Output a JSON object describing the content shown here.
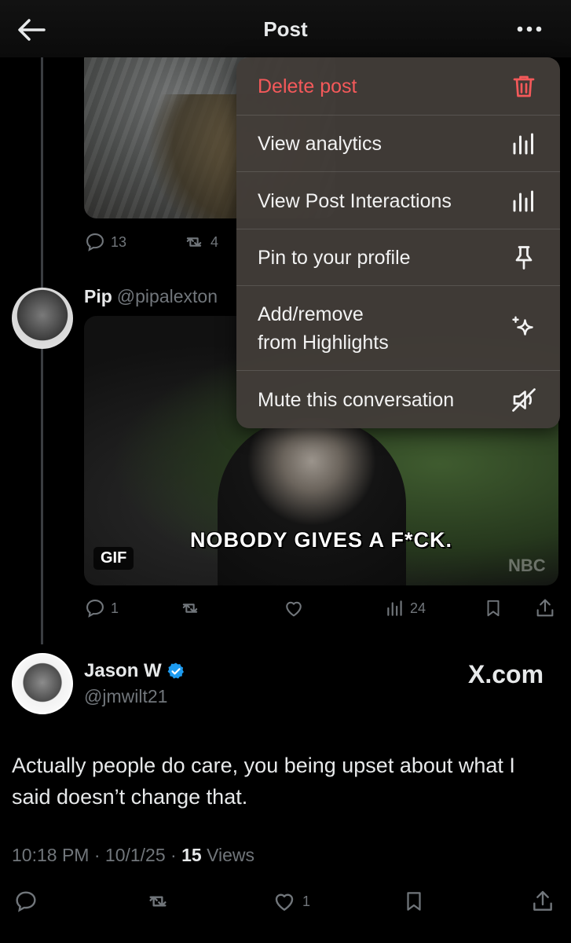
{
  "header": {
    "title": "Post"
  },
  "first_post": {
    "reply_count": "13",
    "repost_count": "4"
  },
  "reply": {
    "name": "Pip",
    "handle": "@pipalexton",
    "gif_caption": "NOBODY GIVES A F*CK.",
    "gif_badge": "GIF",
    "gif_watermark": "NBC",
    "reply_count": "1",
    "view_count": "24"
  },
  "menu": {
    "items": [
      {
        "label": "Delete post",
        "icon": "trash-icon",
        "danger": true
      },
      {
        "label": "View analytics",
        "icon": "analytics-icon"
      },
      {
        "label": "View Post Interactions",
        "icon": "analytics-icon"
      },
      {
        "label": "Pin to your profile",
        "icon": "pin-icon"
      },
      {
        "label_line1": "Add/remove",
        "label_line2": "from Highlights",
        "icon": "sparkle-icon"
      },
      {
        "label": "Mute this conversation",
        "icon": "mute-icon"
      }
    ],
    "danger_color": "#f4595a"
  },
  "main_post": {
    "name": "Jason W",
    "handle": "@jmwilt21",
    "watermark": "X.com",
    "text": "Actually people do care, you being upset about what I said doesn’t change that.",
    "time": "10:18 PM",
    "date": "10/1/25",
    "views_count": "15",
    "views_label": "Views",
    "like_count": "1",
    "verified_color": "#1d9bf0"
  }
}
